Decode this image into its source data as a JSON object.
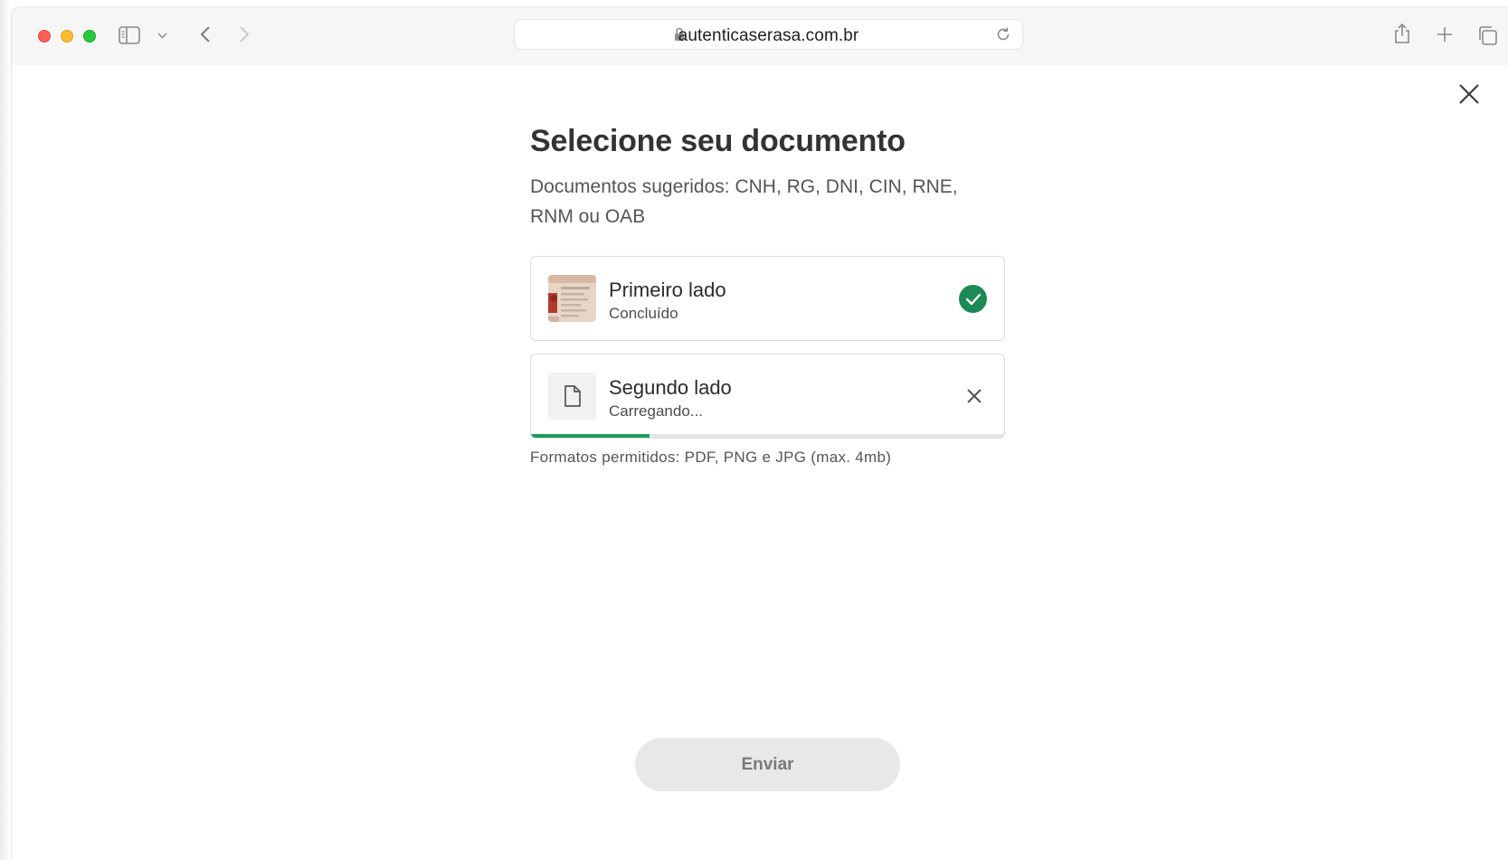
{
  "browser": {
    "url": "autenticaserasa.com.br",
    "icons": [
      "sidebar-icon",
      "chevron-down-icon",
      "back-icon",
      "forward-icon",
      "lock-icon",
      "reload-icon",
      "share-icon",
      "plus-icon",
      "tabs-icon"
    ]
  },
  "page": {
    "title": "Selecione seu documento",
    "subtitle": "Documentos sugeridos: CNH, RG, DNI, CIN, RNE, RNM ou OAB",
    "documents": [
      {
        "label": "Primeiro lado",
        "status": "Concluído",
        "state": "done"
      },
      {
        "label": "Segundo lado",
        "status": "Carregando...",
        "state": "uploading",
        "progress": 0.25
      }
    ],
    "formats_note": "Formatos permitidos: PDF, PNG e JPG (max. 4mb)",
    "submit_label": "Enviar"
  },
  "colors": {
    "accent": "#1d8a55",
    "progress": "#1d9b5a",
    "disabled_button": "#e8e8e8"
  }
}
